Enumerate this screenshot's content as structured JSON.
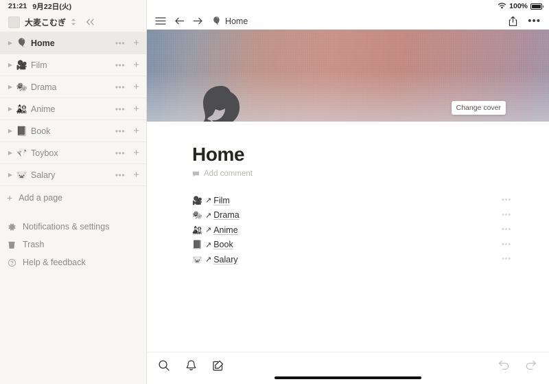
{
  "status_bar": {
    "time": "21:21",
    "date": "9月22日(火)",
    "wifi_icon": "wifi-icon",
    "battery_percent": "100%",
    "battery_icon": "battery-full-icon"
  },
  "sidebar": {
    "workspace": {
      "avatar": "workspace-avatar",
      "name": "大麦こむぎ",
      "switch_icon": "chevron-updown-icon",
      "collapse_icon": "collapse-sidebar-icon",
      "collapse_label": "«"
    },
    "items": [
      {
        "label": "Home",
        "emoji": "🎈",
        "emoji_name": "balloon-icon",
        "active": true
      },
      {
        "label": "Film",
        "emoji": "🎥",
        "emoji_name": "movie-camera-icon",
        "active": false
      },
      {
        "label": "Drama",
        "emoji": "🎭",
        "emoji_name": "drama-masks-icon",
        "active": false
      },
      {
        "label": "Anime",
        "emoji": "🎎",
        "emoji_name": "anime-doll-icon",
        "active": false
      },
      {
        "label": "Book",
        "emoji": "📕",
        "emoji_name": "book-icon",
        "active": false
      },
      {
        "label": "Toybox",
        "emoji": "💎",
        "emoji_name": "gem-icon",
        "active": false
      },
      {
        "label": "Salary",
        "emoji": "🐷",
        "emoji_name": "piggy-bank-icon",
        "active": false
      }
    ],
    "item_more_label": "•••",
    "item_add_label": "+",
    "add_page": {
      "label": "Add a page",
      "icon": "plus-icon"
    },
    "footer": [
      {
        "label": "Notifications & settings",
        "icon": "gear-icon"
      },
      {
        "label": "Trash",
        "icon": "trash-icon"
      },
      {
        "label": "Help & feedback",
        "icon": "question-circle-icon"
      }
    ]
  },
  "topbar": {
    "menu_icon": "hamburger-menu-icon",
    "back_icon": "arrow-left-icon",
    "forward_icon": "arrow-right-icon",
    "breadcrumb_emoji": "🎈",
    "breadcrumb_emoji_name": "balloon-icon",
    "breadcrumb_label": "Home",
    "share_icon": "share-icon",
    "more_icon": "more-options-icon",
    "more_label": "•••"
  },
  "cover": {
    "change_cover_label": "Change cover",
    "gradient_left": "#7d90a9",
    "gradient_mid": "#c99187",
    "gradient_right": "#9e94ab",
    "silhouette_name": "head-silhouette",
    "silhouette_color": "#4d4d4f"
  },
  "page": {
    "title": "Home",
    "comment_icon": "comment-icon",
    "comment_placeholder": "Add comment",
    "links": [
      {
        "label": "Film",
        "emoji": "🎥",
        "emoji_name": "movie-camera-icon",
        "arrow": "↗",
        "more": "•••"
      },
      {
        "label": "Drama",
        "emoji": "🎭",
        "emoji_name": "drama-masks-icon",
        "arrow": "↗",
        "more": "•••"
      },
      {
        "label": "Anime",
        "emoji": "🎎",
        "emoji_name": "anime-doll-icon",
        "arrow": "↗",
        "more": "•••"
      },
      {
        "label": "Book",
        "emoji": "📕",
        "emoji_name": "book-icon",
        "arrow": "↗",
        "more": "•••"
      },
      {
        "label": "Salary",
        "emoji": "🐷",
        "emoji_name": "piggy-bank-icon",
        "arrow": "↗",
        "more": "•••"
      }
    ]
  },
  "bottom_bar": {
    "search_icon": "search-icon",
    "notifications_icon": "bell-icon",
    "new_page_icon": "compose-icon",
    "undo_icon": "undo-icon",
    "redo_icon": "redo-icon",
    "home_indicator": "home-indicator"
  }
}
